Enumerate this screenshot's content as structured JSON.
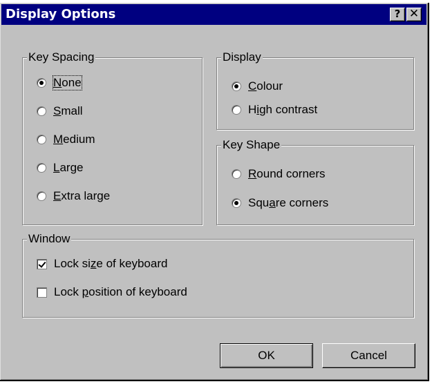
{
  "window": {
    "title": "Display Options",
    "help_glyph": "?",
    "close_glyph": "✕"
  },
  "key_spacing": {
    "legend": "Key Spacing",
    "options": [
      {
        "pre": "",
        "u": "N",
        "post": "one",
        "selected": true
      },
      {
        "pre": "",
        "u": "S",
        "post": "mall",
        "selected": false
      },
      {
        "pre": "",
        "u": "M",
        "post": "edium",
        "selected": false
      },
      {
        "pre": "",
        "u": "L",
        "post": "arge",
        "selected": false
      },
      {
        "pre": "",
        "u": "E",
        "post": "xtra large",
        "selected": false
      }
    ]
  },
  "display": {
    "legend": "Display",
    "options": [
      {
        "pre": "",
        "u": "C",
        "post": "olour",
        "selected": true
      },
      {
        "pre": "H",
        "u": "i",
        "post": "gh contrast",
        "selected": false
      }
    ]
  },
  "key_shape": {
    "legend": "Key Shape",
    "options": [
      {
        "pre": "",
        "u": "R",
        "post": "ound corners",
        "selected": false
      },
      {
        "pre": "Squ",
        "u": "a",
        "post": "re corners",
        "selected": true
      }
    ]
  },
  "window_group": {
    "legend": "Window",
    "options": [
      {
        "pre": "Lock si",
        "u": "z",
        "post": "e of keyboard",
        "checked": true
      },
      {
        "pre": "Lock ",
        "u": "p",
        "post": "osition of keyboard",
        "checked": false
      }
    ]
  },
  "buttons": {
    "ok": "OK",
    "cancel": "Cancel"
  },
  "icons": {
    "radio": "radio-button-icon",
    "checkbox": "checkbox-icon",
    "help": "help-icon",
    "close": "close-icon"
  }
}
